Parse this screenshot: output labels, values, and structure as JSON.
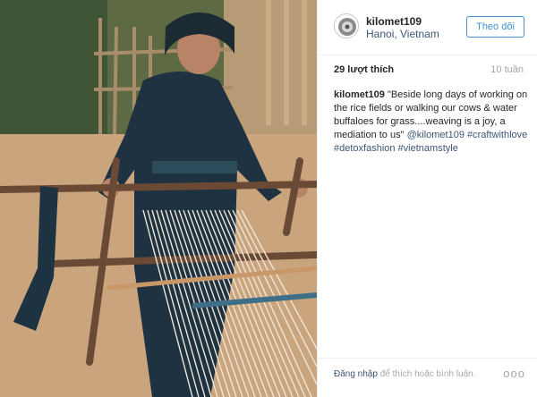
{
  "post": {
    "username": "kilomet109",
    "location": "Hanoi, Vietnam",
    "follow_label": "Theo dõi",
    "likes": "29 lượt thích",
    "time_ago": "10 tuần",
    "caption": {
      "user": "kilomet109",
      "text": "\"Beside long days of working on the rice fields or walking our cows & water buffaloes for grass....weaving is a joy, a mediation to us\"",
      "mention": "@kilomet109",
      "hashtags": "#craftwithlove #detoxfashion #vietnamstyle"
    },
    "footer": {
      "login": "Đăng nhập",
      "rest": "để thích hoặc bình luận.",
      "more": "ooo"
    }
  },
  "icons": {
    "avatar": "avatar-icon",
    "more": "more-options-icon"
  },
  "colors": {
    "follow_blue": "#3e92d7",
    "link_blue": "#3d5573",
    "muted_gray": "#a5a7aa",
    "text_dark": "#262626"
  }
}
